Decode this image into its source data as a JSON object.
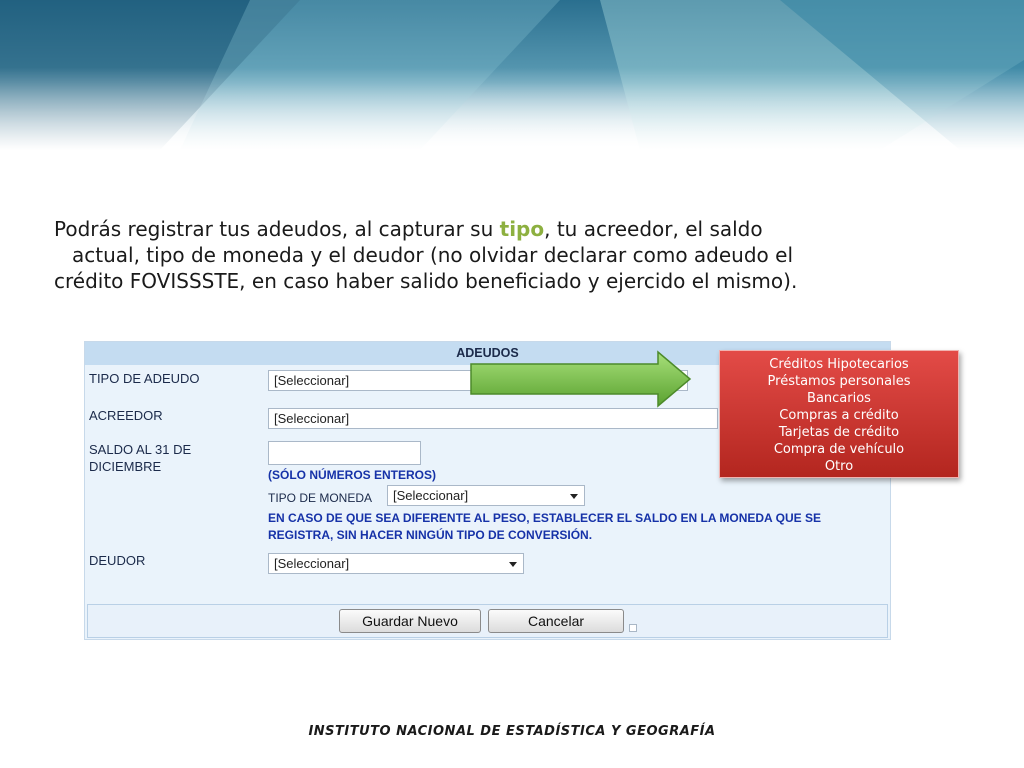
{
  "intro": {
    "line1a": "Podrás registrar tus adeudos,  al capturar  su ",
    "line1_highlight": "tipo",
    "line1b": ", tu acreedor,  el saldo",
    "line2": "actual, tipo de moneda y el deudor (no olvidar declarar como adeudo el",
    "line3": "crédito FOVISSSTE, en caso haber salido beneficiado y ejercido el mismo)."
  },
  "form": {
    "header": "ADEUDOS",
    "tipo_label": "TIPO DE ADEUDO",
    "tipo_value": "[Seleccionar]",
    "acreedor_label": "ACREEDOR",
    "acreedor_value": "[Seleccionar]",
    "saldo_label_1": "SALDO AL 31 DE",
    "saldo_label_2": "DICIEMBRE",
    "saldo_value": "",
    "saldo_note": "(SÓLO NÚMEROS ENTEROS)",
    "moneda_label": "TIPO DE MONEDA",
    "moneda_value": "[Seleccionar]",
    "moneda_note_1": "EN CASO DE QUE SEA DIFERENTE AL PESO, ESTABLECER EL SALDO EN LA MONEDA QUE SE",
    "moneda_note_2": "REGISTRA, SIN HACER NINGÚN TIPO DE CONVERSIÓN.",
    "deudor_label": "DEUDOR",
    "deudor_value": "[Seleccionar]",
    "save_label": "Guardar Nuevo",
    "cancel_label": "Cancelar"
  },
  "popup_options": [
    "Créditos Hipotecarios",
    "Préstamos personales",
    "Bancarios",
    "Compras a crédito",
    "Tarjetas de crédito",
    "Compra de vehículo",
    "Otro"
  ],
  "footer": "INSTITUTO NACIONAL  DE ESTADÍSTICA Y GEOGRAFÍA",
  "colors": {
    "highlight": "#8db040",
    "popup": "#c9302c",
    "note_blue": "#1632a8",
    "arrow_green": "#7cc243"
  }
}
